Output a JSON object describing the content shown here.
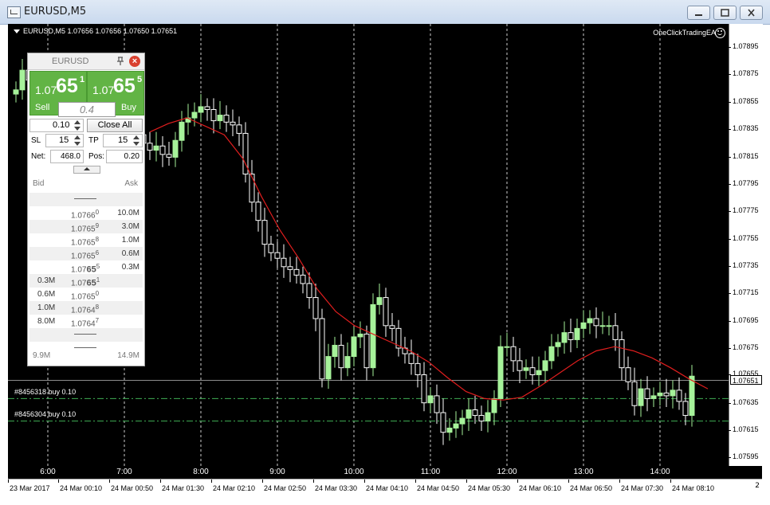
{
  "window": {
    "title": "EURUSD,M5"
  },
  "chart": {
    "header": "EURUSD,M5  1.07656 1.07656 1.07650 1.07651",
    "ea_label": "OneClickTradingEA",
    "colors": {
      "bull": "#a6f29a",
      "bear": "#ffffff",
      "ma": "#e01e1e",
      "grid": "#ffffff",
      "order_line": "#3fae55"
    },
    "price_ticks": [
      "1.07895",
      "1.07875",
      "1.07855",
      "1.07835",
      "1.07815",
      "1.07795",
      "1.07775",
      "1.07755",
      "1.07735",
      "1.07715",
      "1.07695",
      "1.07675",
      "1.07655",
      "1.07635",
      "1.07615",
      "1.07595"
    ],
    "current_price": "1.07651",
    "time_ticks": [
      "6:00",
      "7:00",
      "8:00",
      "9:00",
      "10:00",
      "11:00",
      "12:00",
      "13:00",
      "14:00"
    ],
    "bottom_labels": [
      "23 Mar 2017",
      "24 Mar 00:10",
      "24 Mar 00:50",
      "24 Mar 01:30",
      "24 Mar 02:10",
      "24 Mar 02:50",
      "24 Mar 03:30",
      "24 Mar 04:10",
      "24 Mar 04:50",
      "24 Mar 05:30",
      "24 Mar 06:10",
      "24 Mar 06:50",
      "24 Mar 07:30",
      "24 Mar 08:10"
    ],
    "orders": [
      {
        "label": "#8456318 buy 0.10",
        "price": 1.07638
      },
      {
        "label": "#8456304 buy 0.10",
        "price": 1.07622
      }
    ],
    "scroll_mark": "2"
  },
  "chart_data": {
    "type": "candlestick",
    "symbol": "EURUSD",
    "timeframe": "M5",
    "ylim": [
      1.0759,
      1.07905
    ],
    "last_price": 1.07651,
    "close_series": [
      1.07858,
      1.07872,
      1.07865,
      1.07852,
      1.0784,
      1.0783,
      1.07826,
      1.07822,
      1.07818,
      1.0782,
      1.07824,
      1.07818,
      1.07815,
      1.07812,
      1.07818,
      1.07822,
      1.07821,
      1.07823,
      1.07822,
      1.07826,
      1.0782,
      1.07815,
      1.07818,
      1.07812,
      1.0781,
      1.07822,
      1.07835,
      1.07838,
      1.07842,
      1.07846,
      1.07844,
      1.07836,
      1.0784,
      1.07835,
      1.07833,
      1.07827,
      1.07798,
      1.07778,
      1.07765,
      1.07748,
      1.07742,
      1.07738,
      1.07732,
      1.0773,
      1.07726,
      1.0772,
      1.0771,
      1.07695,
      1.07652,
      1.07668,
      1.07676,
      1.0766,
      1.07668,
      1.07682,
      1.07684,
      1.0766,
      1.07705,
      1.0771,
      1.0769,
      1.07688,
      1.07674,
      1.0767,
      1.07663,
      1.07655,
      1.07635,
      1.0764,
      1.07628,
      1.07614,
      1.07617,
      1.0762,
      1.07624,
      1.0763,
      1.07626,
      1.07622,
      1.07628,
      1.07638,
      1.07675,
      1.07675,
      1.07665,
      1.07658,
      1.0766,
      1.07655,
      1.07658,
      1.07665,
      1.07675,
      1.07678,
      1.07685,
      1.0768,
      1.07688,
      1.07692,
      1.07695,
      1.0769,
      1.0769,
      1.0769,
      1.0768,
      1.0766,
      1.0765,
      1.07633,
      1.07645,
      1.07638,
      1.0764,
      1.07642,
      1.0764,
      1.07644,
      1.07636,
      1.07626,
      1.07654
    ],
    "ma_series": [
      1.07828,
      1.07834,
      1.07838,
      1.07832,
      1.07826,
      1.07809,
      1.07782,
      1.07758,
      1.07738,
      1.07716,
      1.077,
      1.0769,
      1.07684,
      1.07678,
      1.07672,
      1.07664,
      1.07653,
      1.07643,
      1.07638,
      1.07637,
      1.07639,
      1.07647,
      1.07656,
      1.07665,
      1.07672,
      1.07675,
      1.07672,
      1.07667,
      1.0766,
      1.07652,
      1.07645
    ],
    "order_levels": [
      1.07638,
      1.07622
    ]
  },
  "panel": {
    "symbol": "EURUSD",
    "close": "×",
    "sell": {
      "prefix": "1.07",
      "big": "65",
      "sup": "1",
      "label": "Sell"
    },
    "buy": {
      "prefix": "1.07",
      "big": "65",
      "sup": "5",
      "label": "Buy"
    },
    "spread": "0.4",
    "lot": "0.10",
    "close_all": "Close All",
    "sl_label": "SL",
    "sl": "15",
    "tp_label": "TP",
    "tp": "15",
    "net_label": "Net:",
    "net": "468.0",
    "pos_label": "Pos:",
    "pos": "0.20",
    "dom_bid_header": "Bid",
    "dom_ask_header": "Ask",
    "dom": [
      {
        "bid": "",
        "price": "",
        "sup": "",
        "ask": "",
        "dash": true
      },
      {
        "bid": "",
        "pre": "1.0766",
        "bold": "",
        "sup": "0",
        "ask": "10.0M"
      },
      {
        "bid": "",
        "pre": "1.0765",
        "bold": "",
        "sup": "9",
        "ask": "3.0M"
      },
      {
        "bid": "",
        "pre": "1.0765",
        "bold": "",
        "sup": "8",
        "ask": "1.0M"
      },
      {
        "bid": "",
        "pre": "1.0765",
        "bold": "",
        "sup": "6",
        "ask": "0.6M"
      },
      {
        "bid": "",
        "pre": "1.07",
        "bold": "65",
        "sup": "5",
        "ask": "0.3M"
      },
      {
        "bid": "0.3M",
        "pre": "1.07",
        "bold": "65",
        "sup": "1",
        "ask": ""
      },
      {
        "bid": "0.6M",
        "pre": "1.0765",
        "bold": "",
        "sup": "0",
        "ask": ""
      },
      {
        "bid": "1.0M",
        "pre": "1.0764",
        "bold": "",
        "sup": "8",
        "ask": ""
      },
      {
        "bid": "8.0M",
        "pre": "1.0764",
        "bold": "",
        "sup": "7",
        "ask": ""
      },
      {
        "bid": "",
        "price": "",
        "sup": "",
        "ask": "",
        "dash": true
      },
      {
        "bid": "",
        "price": "",
        "sup": "",
        "ask": "",
        "dash": true
      }
    ],
    "total_bid": "9.9M",
    "total_ask": "14.9M"
  }
}
